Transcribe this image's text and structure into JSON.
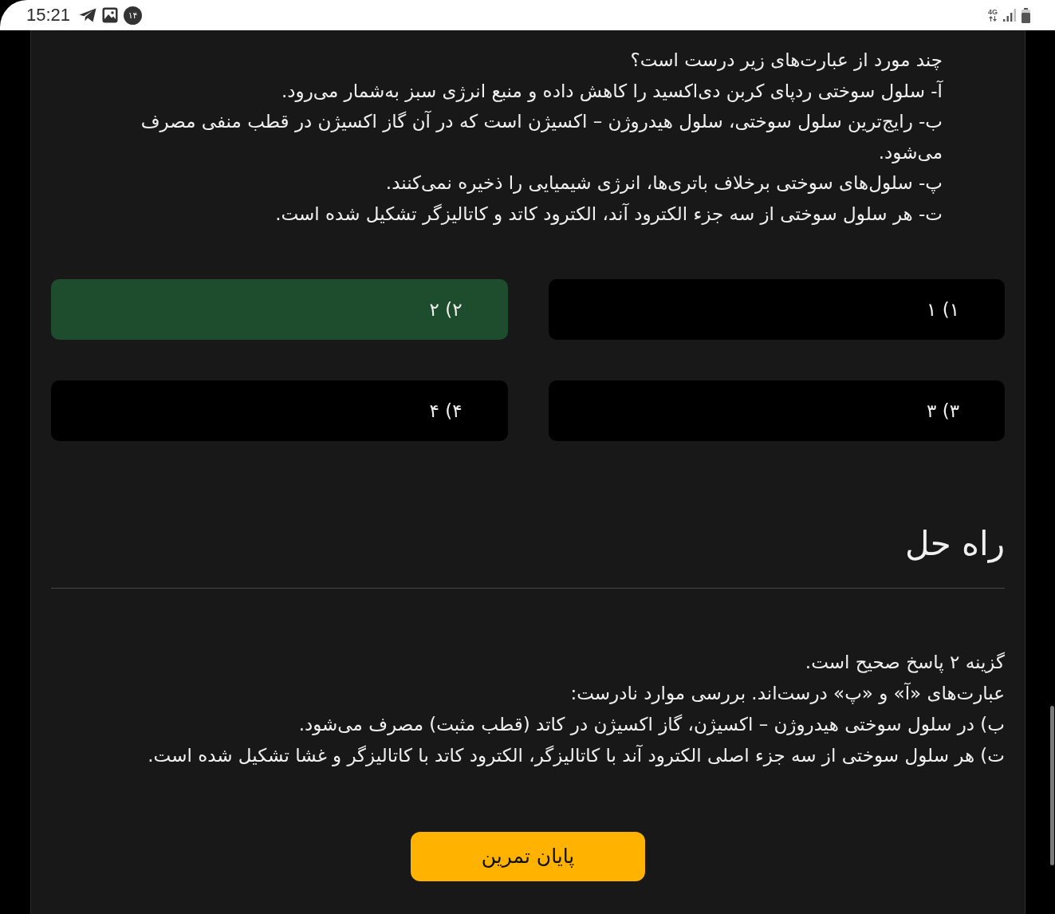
{
  "status_bar": {
    "time": "15:21",
    "notification_count": "۱۴",
    "network": "4G"
  },
  "question": {
    "lines": [
      "چند مورد از عبارت‌های زیر درست است؟",
      "آ- سلول سوختی ردپای کربن دی‌اکسید را کاهش داده و منبع انرژی سبز به‌شمار می‌رود.",
      "ب- رایج‌ترین سلول سوختی، سلول هیدروژن – اکسیژن است که در آن گاز اکسیژن در قطب منفی مصرف می‌شود.",
      "پ- سلول‌های سوختی برخلاف باتری‌ها، انرژی شیمیایی را ذخیره نمی‌کنند.",
      "ت- هر سلول سوختی از سه جزء الکترود آند، الکترود کاتد و کاتالیزگر تشکیل شده است."
    ]
  },
  "options": [
    {
      "label": "۱) ۱",
      "selected": false
    },
    {
      "label": "۲) ۲",
      "selected": true
    },
    {
      "label": "۳) ۳",
      "selected": false
    },
    {
      "label": "۴) ۴",
      "selected": false
    }
  ],
  "solution": {
    "title": "راه حل",
    "lines": [
      "گزینه ۲ پاسخ صحیح است.",
      "عبارت‌های «آ» و «پ» درست‌اند. بررسی موارد نادرست:",
      "ب) در سلول سوختی هیدروژن – اکسیژن، گاز اکسیژن در کاتد (قطب مثبت) مصرف می‌شود.",
      "ت) هر سلول سوختی از سه جزء اصلی الکترود آند با کاتالیزگر، الکترود کاتد با کاتالیزگر و غشا تشکیل شده است."
    ]
  },
  "finish_button": {
    "label": "پایان تمرین"
  }
}
